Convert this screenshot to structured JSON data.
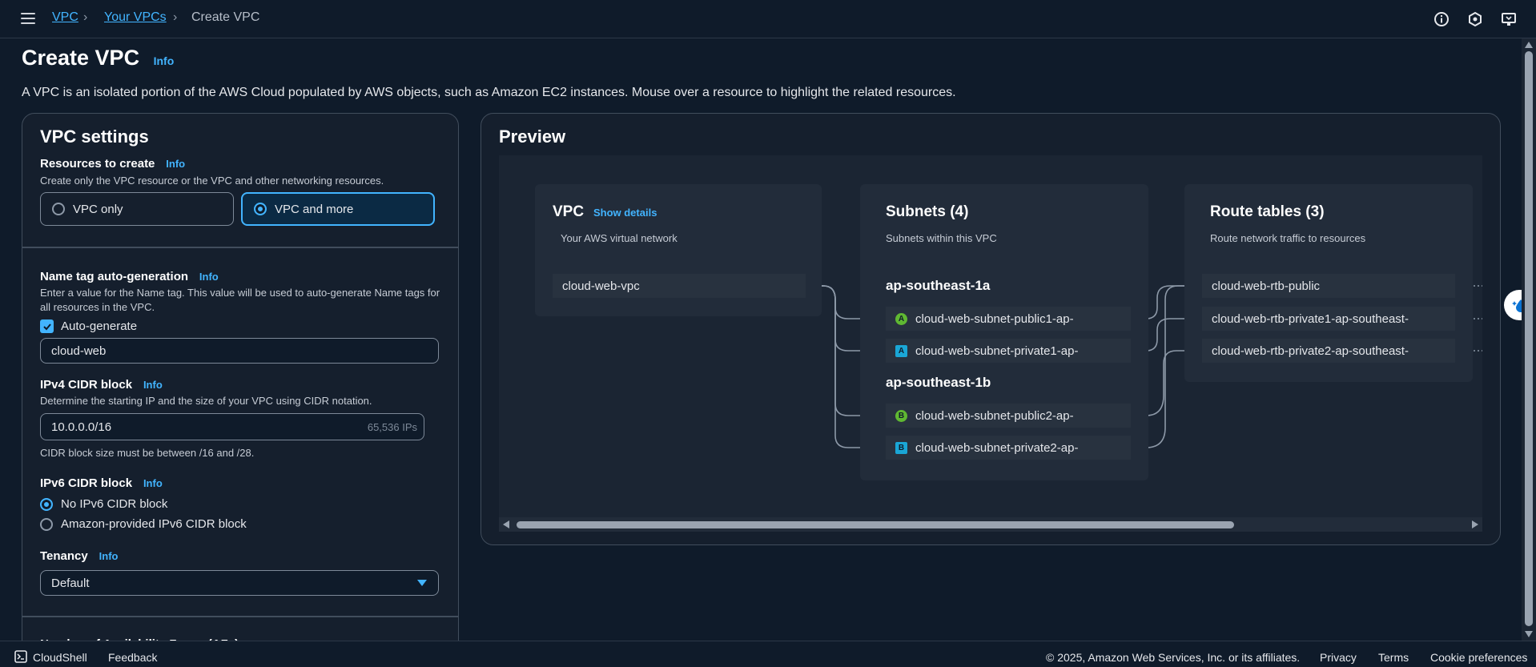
{
  "breadcrumb": {
    "root": "VPC",
    "parent": "Your VPCs",
    "current": "Create VPC"
  },
  "icons": {
    "menu": "hamburger-icon",
    "info": "info-circle-icon",
    "notifications": "notifications-icon",
    "feedback": "monitor-feedback-icon"
  },
  "page": {
    "title": "Create VPC",
    "info": "Info",
    "description": "A VPC is an isolated portion of the AWS Cloud populated by AWS objects, such as Amazon EC2 instances. Mouse over a resource to highlight the related resources."
  },
  "settings": {
    "title": "VPC settings",
    "resources": {
      "label": "Resources to create",
      "info": "Info",
      "help": "Create only the VPC resource or the VPC and other networking resources.",
      "options": [
        "VPC only",
        "VPC and more"
      ],
      "selected": "VPC and more"
    },
    "name_tag": {
      "label": "Name tag auto-generation",
      "info": "Info",
      "help": "Enter a value for the Name tag. This value will be used to auto-generate Name tags for all resources in the VPC.",
      "checkbox_label": "Auto-generate",
      "checked": true,
      "value": "cloud-web"
    },
    "ipv4": {
      "label": "IPv4 CIDR block",
      "info": "Info",
      "help": "Determine the starting IP and the size of your VPC using CIDR notation.",
      "value": "10.0.0.0/16",
      "ip_count": "65,536 IPs",
      "constraint": "CIDR block size must be between /16 and /28."
    },
    "ipv6": {
      "label": "IPv6 CIDR block",
      "info": "Info",
      "options": [
        "No IPv6 CIDR block",
        "Amazon-provided IPv6 CIDR block"
      ],
      "selected": "No IPv6 CIDR block"
    },
    "tenancy": {
      "label": "Tenancy",
      "info": "Info",
      "value": "Default"
    },
    "next_section_partial": "Number of Availability Zones (AZs)"
  },
  "preview": {
    "title": "Preview",
    "vpc": {
      "title": "VPC",
      "show_details": "Show details",
      "subtitle": "Your AWS virtual network",
      "name": "cloud-web-vpc"
    },
    "subnets": {
      "title": "Subnets (4)",
      "subtitle": "Subnets within this VPC",
      "zones": [
        {
          "name": "ap-southeast-1a",
          "items": [
            {
              "badge": "A",
              "kind": "public",
              "name": "cloud-web-subnet-public1-ap-"
            },
            {
              "badge": "A",
              "kind": "private",
              "name": "cloud-web-subnet-private1-ap-"
            }
          ]
        },
        {
          "name": "ap-southeast-1b",
          "items": [
            {
              "badge": "B",
              "kind": "public",
              "name": "cloud-web-subnet-public2-ap-"
            },
            {
              "badge": "B",
              "kind": "private",
              "name": "cloud-web-subnet-private2-ap-"
            }
          ]
        }
      ]
    },
    "route_tables": {
      "title": "Route tables (3)",
      "subtitle": "Route network traffic to resources",
      "items": [
        "cloud-web-rtb-public",
        "cloud-web-rtb-private1-ap-southeast-",
        "cloud-web-rtb-private2-ap-southeast-"
      ]
    }
  },
  "footer": {
    "cloudshell": "CloudShell",
    "feedback": "Feedback",
    "copyright": "© 2025, Amazon Web Services, Inc. or its affiliates.",
    "privacy": "Privacy",
    "terms": "Terms",
    "cookies": "Cookie preferences"
  },
  "colors": {
    "accent": "#42b4ff",
    "background": "#0f1b2a",
    "panel": "#151f2d",
    "public_badge": "#5fb832",
    "private_badge": "#1aa6d6"
  }
}
